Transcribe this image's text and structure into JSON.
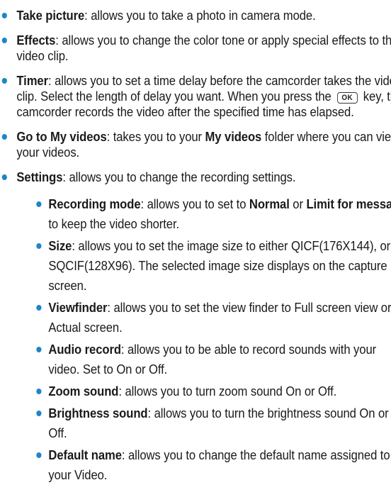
{
  "colors": {
    "bullet": "#1b86c8",
    "text": "#1a1a1a"
  },
  "items": [
    {
      "title": "Take picture",
      "text": ": allows you to take a photo in camera mode."
    },
    {
      "title": "Effects",
      "text": ": allows you to change the color tone or apply special effects to the video clip."
    },
    {
      "title": "Timer",
      "text_before_key": ": allows you to set a time delay before the camcorder takes the video clip. Select the length of delay you want. When you press the ",
      "key_label": "OK",
      "key_icon": "ok-key-icon",
      "text_after_key": " key, the camcorder records the video after the specified time has elapsed."
    },
    {
      "title": "Go to My videos",
      "text_a": ": takes you to your ",
      "folder": "My videos",
      "text_b": " folder where you can view your videos."
    },
    {
      "title": "Settings",
      "text": ": allows you to change the recording settings.",
      "sub": [
        {
          "title": "Recording mode",
          "text_a": ": allows you to set to ",
          "opt1": "Normal",
          "text_b": " or ",
          "opt2": "Limit for message",
          "text_c": " to keep the video shorter."
        },
        {
          "title": "Size",
          "text": ": allows you to set the image size to either QICF(176X144), or SQCIF(128X96). The selected image size displays on the capture screen."
        },
        {
          "title": "Viewfinder",
          "text": ": allows you to set the view finder to Full screen view or Actual screen."
        },
        {
          "title": "Audio record",
          "text": ": allows you to be able to record sounds with your video. Set to On or Off."
        },
        {
          "title": "Zoom sound",
          "text": ": allows you to turn zoom sound On or Off."
        },
        {
          "title": "Brightness sound",
          "text": ": allows you to turn the brightness sound On or Off."
        },
        {
          "title": "Default name",
          "text": ": allows you to change the default name assigned to your Video."
        }
      ]
    }
  ]
}
